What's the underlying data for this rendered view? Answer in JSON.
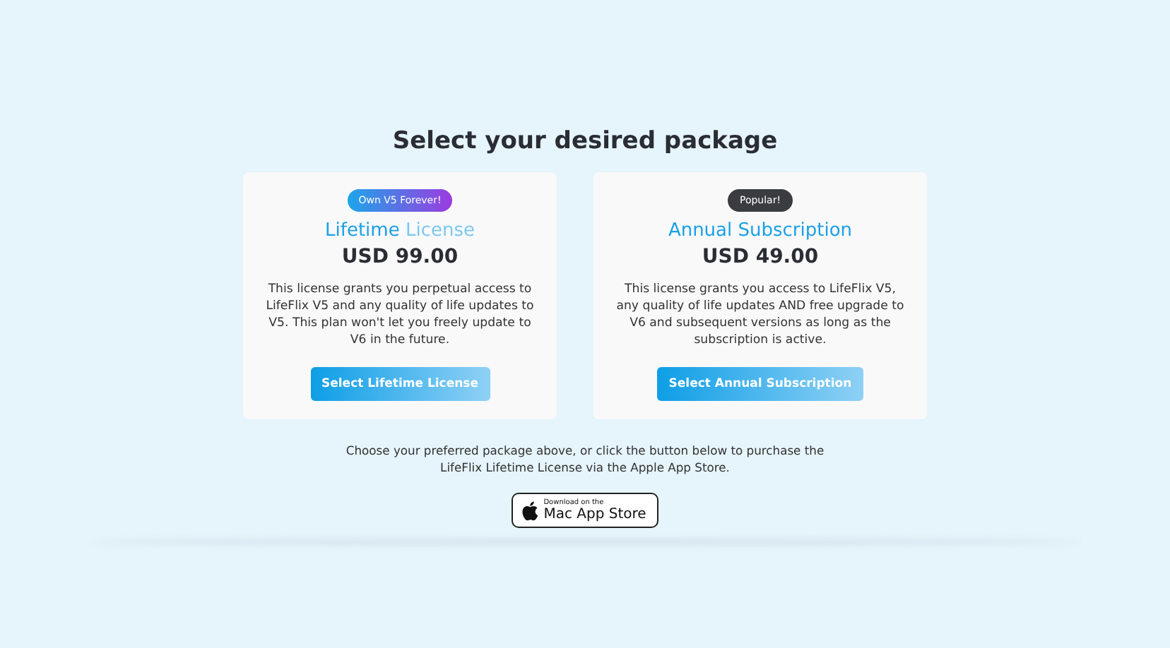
{
  "heading": "Select your desired package",
  "packages": [
    {
      "kind": "gradient",
      "badge": "Own V5 Forever!",
      "title": "**Lifetime** License",
      "price": "USD 99.00",
      "description": "This license grants you perpetual access to LifeFlix V5 and any quality of life updates to V5. This plan won't let you freely update to V6 in the future.",
      "button": "Select Lifetime License"
    },
    {
      "kind": "dark",
      "badge": "Popular!",
      "title": "Annual Subscription",
      "price": "USD 49.00",
      "description": "This license grants you access to LifeFlix V5, any quality of life updates AND free upgrade to V6 and subsequent versions as long as the subscription is active.",
      "button": "Select Annual Subscription"
    }
  ],
  "note": "Choose your preferred package above, or click the button below to purchase the LifeFlix Lifetime License via the Apple App Store.",
  "store_button": {
    "small": "Download on the",
    "large": "Mac App Store"
  }
}
